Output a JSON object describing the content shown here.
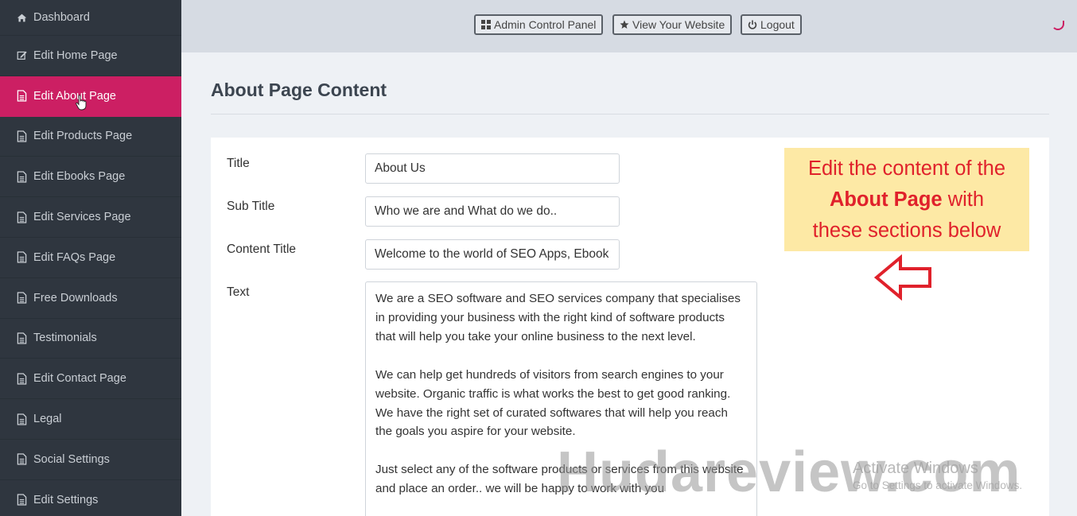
{
  "sidebar": {
    "items": [
      {
        "label": "Dashboard",
        "icon": "home-icon"
      },
      {
        "label": "Edit Home Page",
        "icon": "edit-icon"
      },
      {
        "label": "Edit About Page",
        "icon": "file-icon",
        "active": true
      },
      {
        "label": "Edit Products Page",
        "icon": "file-icon"
      },
      {
        "label": "Edit Ebooks Page",
        "icon": "file-icon"
      },
      {
        "label": "Edit Services Page",
        "icon": "file-icon"
      },
      {
        "label": "Edit FAQs Page",
        "icon": "file-icon"
      },
      {
        "label": "Free Downloads",
        "icon": "file-icon"
      },
      {
        "label": "Testimonials",
        "icon": "file-icon"
      },
      {
        "label": "Edit Contact Page",
        "icon": "file-icon"
      },
      {
        "label": "Legal",
        "icon": "file-icon"
      },
      {
        "label": "Social Settings",
        "icon": "file-icon"
      },
      {
        "label": "Edit Settings",
        "icon": "file-icon"
      }
    ]
  },
  "topbar": {
    "admin_label": "Admin Control Panel",
    "view_label": "View Your Website",
    "logout_label": "Logout"
  },
  "main": {
    "title": "About Page Content",
    "fields": {
      "title_label": "Title",
      "title_value": "About Us",
      "subtitle_label": "Sub Title",
      "subtitle_value": "Who we are and What do we do..",
      "content_title_label": "Content Title",
      "content_title_value": "Welcome to the world of SEO Apps, Ebook",
      "text_label": "Text",
      "text_paragraphs": [
        "We are a SEO software and SEO services company that specialises in providing your business with the right kind of software products that will help you take your online business to the next level.",
        "We can help get hundreds of visitors from search engines to your website. Organic traffic is what works the best to get good ranking. We have the right set of curated softwares that will help you reach the goals you aspire for your website.",
        "Just select any of the software products or services from this website and place an order.. we will be happy to work with you"
      ]
    }
  },
  "callout": {
    "line1": "Edit the content of the",
    "line2_bold": "About Page",
    "line2_rest": " with",
    "line3": "these sections below"
  },
  "watermark": {
    "site": "Hudareview.com",
    "windows_title": "Activate Windows",
    "windows_sub": "Go to Settings to activate Windows."
  },
  "colors": {
    "sidebar_bg": "#2f363f",
    "active_bg": "#cc1f63",
    "callout_bg": "#fde9a5",
    "callout_text": "#e0212b"
  }
}
